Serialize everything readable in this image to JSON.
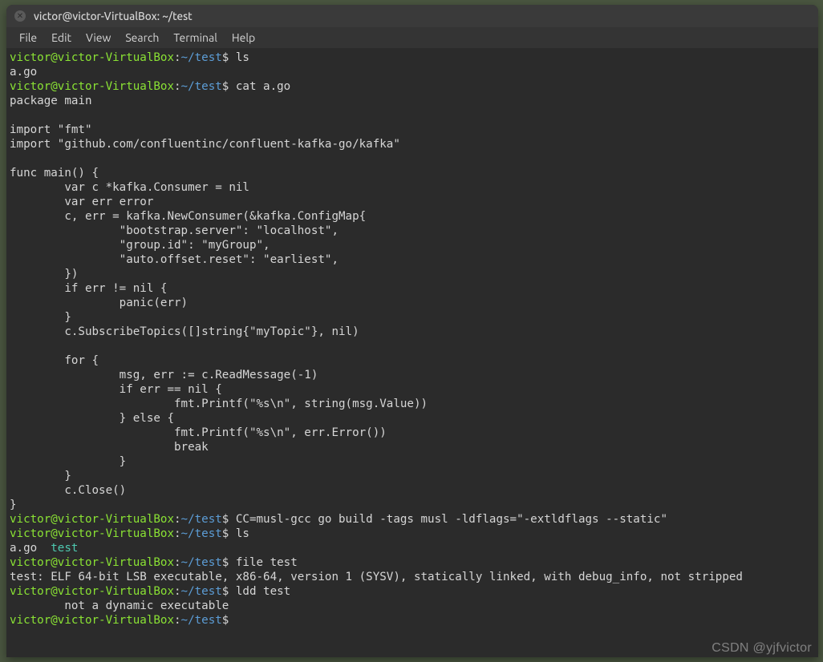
{
  "window": {
    "title": "victor@victor-VirtualBox: ~/test"
  },
  "menu": {
    "file": "File",
    "edit": "Edit",
    "view": "View",
    "search": "Search",
    "terminal": "Terminal",
    "help": "Help"
  },
  "prompt": {
    "user_host": "victor@victor-VirtualBox",
    "sep": ":",
    "path": "~/test",
    "sym": "$"
  },
  "cmds": {
    "ls1": "ls",
    "cat": "cat a.go",
    "build": "CC=musl-gcc go build -tags musl -ldflags=\"-extldflags --static\"",
    "ls2": "ls",
    "file": "file test",
    "ldd": "ldd test",
    "empty": ""
  },
  "out": {
    "ls1": "a.go",
    "ls2_plain": "a.go  ",
    "ls2_exec": "test",
    "file": "test: ELF 64-bit LSB executable, x86-64, version 1 (SYSV), statically linked, with debug_info, not stripped",
    "ldd": "        not a dynamic executable"
  },
  "src": {
    "l01": "package main",
    "l02": "",
    "l03": "import \"fmt\"",
    "l04": "import \"github.com/confluentinc/confluent-kafka-go/kafka\"",
    "l05": "",
    "l06": "func main() {",
    "l07": "        var c *kafka.Consumer = nil",
    "l08": "        var err error",
    "l09": "        c, err = kafka.NewConsumer(&kafka.ConfigMap{",
    "l10": "                \"bootstrap.server\": \"localhost\",",
    "l11": "                \"group.id\": \"myGroup\",",
    "l12": "                \"auto.offset.reset\": \"earliest\",",
    "l13": "        })",
    "l14": "        if err != nil {",
    "l15": "                panic(err)",
    "l16": "        }",
    "l17": "        c.SubscribeTopics([]string{\"myTopic\"}, nil)",
    "l18": "",
    "l19": "        for {",
    "l20": "                msg, err := c.ReadMessage(-1)",
    "l21": "                if err == nil {",
    "l22": "                        fmt.Printf(\"%s\\n\", string(msg.Value))",
    "l23": "                } else {",
    "l24": "                        fmt.Printf(\"%s\\n\", err.Error())",
    "l25": "                        break",
    "l26": "                }",
    "l27": "        }",
    "l28": "        c.Close()",
    "l29": "}"
  },
  "watermark": "CSDN @yjfvictor"
}
